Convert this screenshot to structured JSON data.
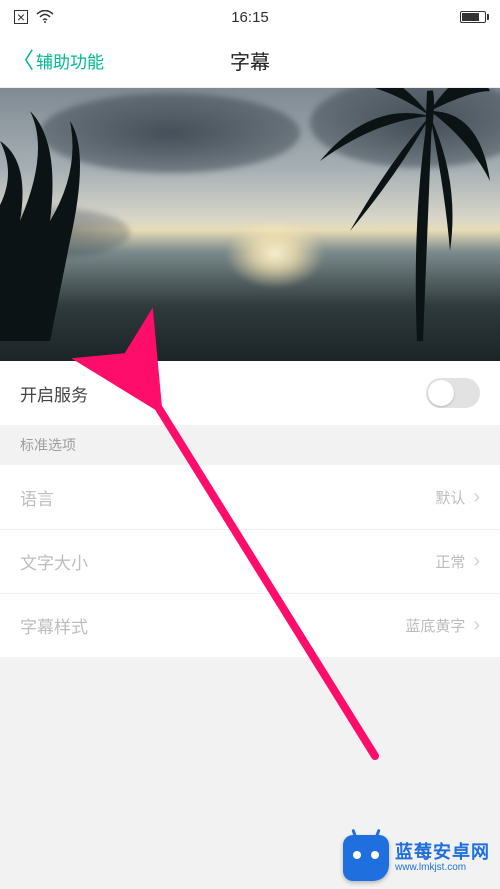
{
  "status": {
    "time": "16:15",
    "close_icon": "⊠",
    "wifi_icon": "wifi-icon"
  },
  "nav": {
    "back_label": "辅助功能",
    "title": "字幕"
  },
  "service": {
    "label": "开启服务",
    "on": false
  },
  "section_header": "标准选项",
  "options": {
    "language": {
      "label": "语言",
      "value": "默认"
    },
    "text_size": {
      "label": "文字大小",
      "value": "正常"
    },
    "caption_style": {
      "label": "字幕样式",
      "value": "蓝底黄字"
    }
  },
  "watermark": {
    "title": "蓝莓安卓网",
    "url": "www.lmkjst.com"
  },
  "annotation": {
    "arrow_color": "#ff0d6b"
  }
}
